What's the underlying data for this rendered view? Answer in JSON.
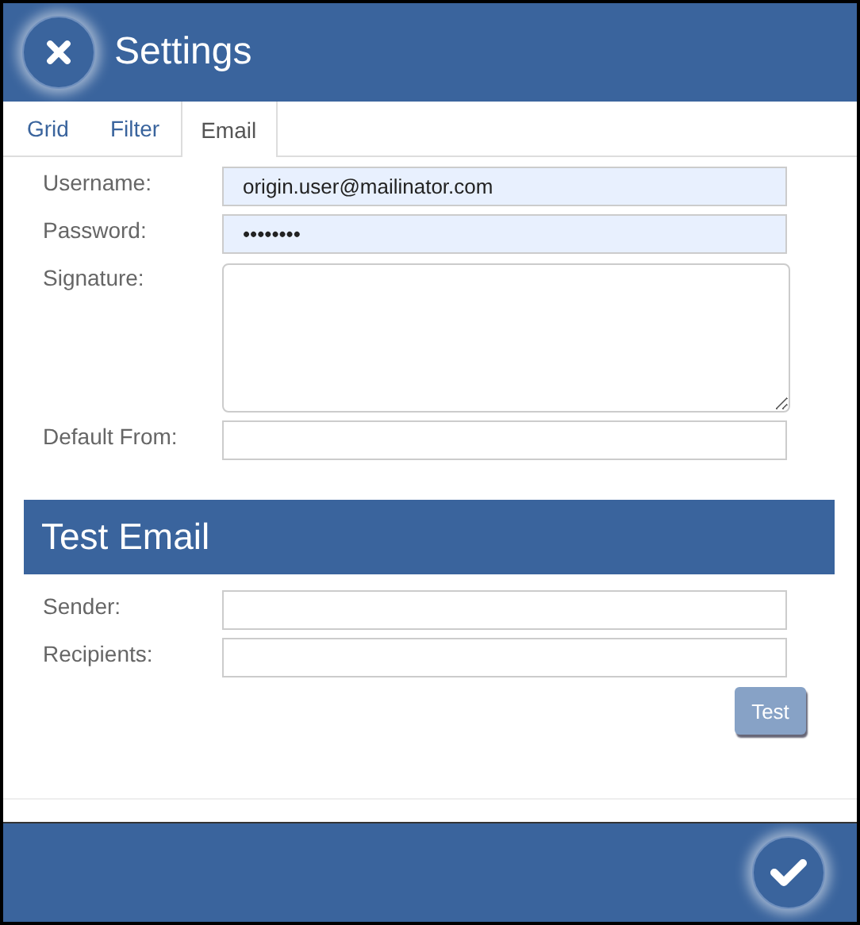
{
  "window": {
    "title": "Settings"
  },
  "tabs": [
    {
      "label": "Grid",
      "selected": false
    },
    {
      "label": "Filter",
      "selected": false
    },
    {
      "label": "Email",
      "selected": true
    }
  ],
  "email_fields": [
    {
      "label": "Username:",
      "kind": "text",
      "value": "origin.user@mailinator.com",
      "autofilled": true
    },
    {
      "label": "Password:",
      "kind": "text",
      "value": "••••••••",
      "autofilled": true
    },
    {
      "label": "Signature:",
      "kind": "textarea",
      "autofilled": false
    },
    {
      "label": "Default From:",
      "kind": "text",
      "autofilled": false
    }
  ],
  "test_section": {
    "title": "Test Email",
    "fields": [
      {
        "label": "Sender:",
        "kind": "text",
        "autofilled": false
      },
      {
        "label": "Recipients:",
        "kind": "text",
        "autofilled": false
      }
    ],
    "button": {
      "label": "Test",
      "disabled": true
    }
  }
}
